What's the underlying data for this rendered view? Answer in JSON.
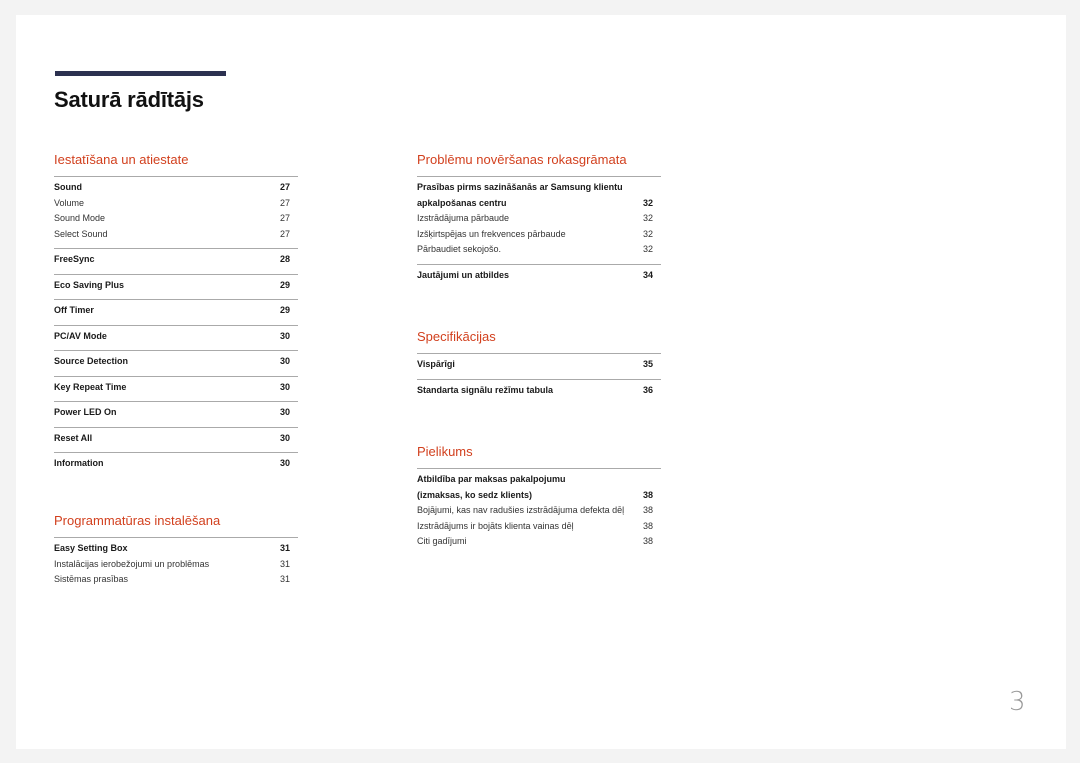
{
  "header": {
    "title": "Saturā rādītājs"
  },
  "sections": {
    "setup": {
      "title": "Iestatīšana un atiestate",
      "groups": [
        {
          "main": {
            "label": "Sound",
            "page": "27"
          },
          "subs": [
            {
              "label": "Volume",
              "page": "27"
            },
            {
              "label": "Sound Mode",
              "page": "27"
            },
            {
              "label": "Select Sound",
              "page": "27"
            }
          ]
        },
        {
          "main": {
            "label": "FreeSync",
            "page": "28"
          }
        },
        {
          "main": {
            "label": "Eco Saving Plus",
            "page": "29"
          }
        },
        {
          "main": {
            "label": "Off Timer",
            "page": "29"
          }
        },
        {
          "main": {
            "label": "PC/AV Mode",
            "page": "30"
          }
        },
        {
          "main": {
            "label": "Source Detection",
            "page": "30"
          }
        },
        {
          "main": {
            "label": "Key Repeat Time",
            "page": "30"
          }
        },
        {
          "main": {
            "label": "Power LED On",
            "page": "30"
          }
        },
        {
          "main": {
            "label": "Reset All",
            "page": "30"
          }
        },
        {
          "main": {
            "label": "Information",
            "page": "30"
          }
        }
      ]
    },
    "software": {
      "title": "Programmatūras instalēšana",
      "groups": [
        {
          "main": {
            "label": "Easy Setting Box",
            "page": "31"
          },
          "subs": [
            {
              "label": "Instalācijas ierobežojumi un problēmas",
              "page": "31"
            },
            {
              "label": "Sistēmas prasības",
              "page": "31"
            }
          ]
        }
      ]
    },
    "troubleshooting": {
      "title": "Problēmu novēršanas rokasgrāmata",
      "groups": [
        {
          "main": {
            "label_line1": "Prasības pirms sazināšanās ar Samsung klientu",
            "label": "apkalpošanas centru",
            "page": "32"
          },
          "subs": [
            {
              "label": "Izstrādājuma pārbaude",
              "page": "32"
            },
            {
              "label": "Izšķirtspējas un frekvences pārbaude",
              "page": "32"
            },
            {
              "label": "Pārbaudiet sekojošo.",
              "page": "32"
            }
          ]
        },
        {
          "main": {
            "label": "Jautājumi un atbildes",
            "page": "34"
          }
        }
      ]
    },
    "specs": {
      "title": "Specifikācijas",
      "groups": [
        {
          "main": {
            "label": "Vispārīgi",
            "page": "35"
          }
        },
        {
          "main": {
            "label": "Standarta signālu režīmu tabula",
            "page": "36"
          }
        }
      ]
    },
    "appendix": {
      "title": "Pielikums",
      "groups": [
        {
          "main": {
            "label_line1": "Atbildība par maksas pakalpojumu",
            "label": "(izmaksas, ko sedz klients)",
            "page": "38"
          },
          "subs": [
            {
              "label": "Bojājumi, kas nav radušies izstrādājuma defekta dēļ",
              "page": "38"
            },
            {
              "label": "Izstrādājums ir bojāts klienta vainas dēļ",
              "page": "38"
            },
            {
              "label": "Citi gadījumi",
              "page": "38"
            }
          ]
        }
      ]
    }
  },
  "footer": {
    "page_number": "3"
  },
  "colors": {
    "accent": "#d2401e",
    "title_bar": "#2c3150",
    "background": "#f3f3f3"
  }
}
